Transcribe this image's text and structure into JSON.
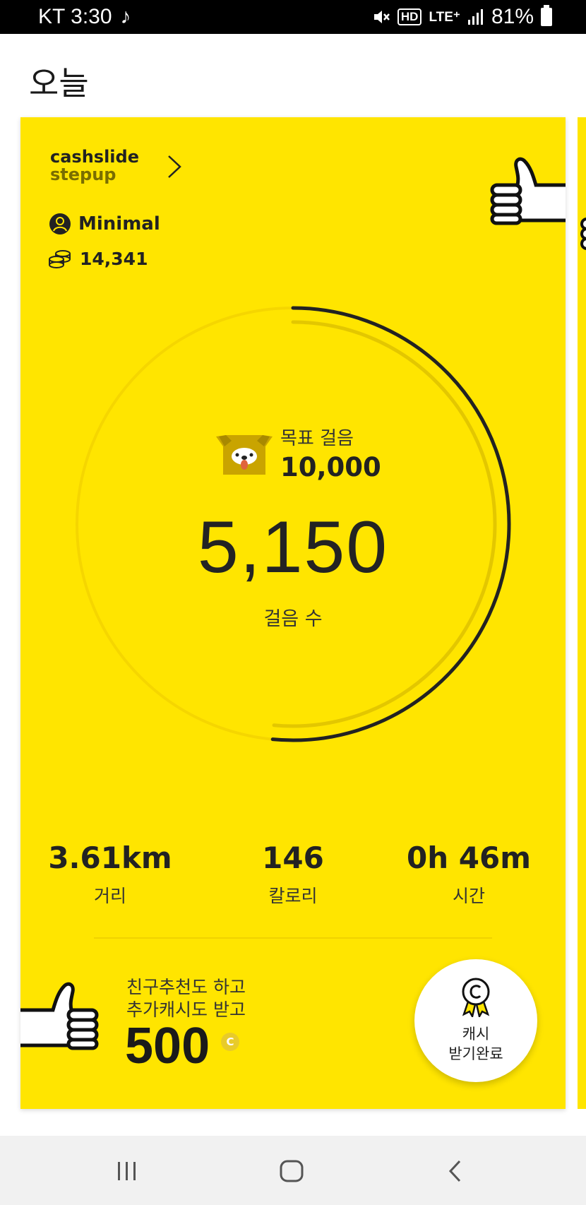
{
  "status_bar": {
    "carrier_time": "KT 3:30",
    "music_icon": "music-note-icon",
    "hd_label": "HD",
    "network": "LTE⁺",
    "battery_percent": "81%"
  },
  "header": {
    "title": "오늘"
  },
  "card": {
    "brand_line1": "cashslide",
    "brand_line2": "stepup",
    "profile_name": "Minimal",
    "coins": "14,341",
    "goal_label": "목표 걸음",
    "goal_value": "10,000",
    "steps_value": "5,150",
    "steps_label": "걸음 수",
    "progress_fraction": 0.515,
    "stats": [
      {
        "value": "3.61km",
        "label": "거리"
      },
      {
        "value": "146",
        "label": "칼로리"
      },
      {
        "value": "0h 46m",
        "label": "시간"
      }
    ],
    "promo_line1": "친구추천도 하고",
    "promo_line2": "추가캐시도 받고",
    "promo_amount": "500",
    "promo_coin_symbol": "C",
    "reward_line1": "캐시",
    "reward_line2": "받기완료",
    "accent_color": "#ffe500"
  },
  "nav": {
    "recent_icon": "recent-apps-icon",
    "home_icon": "home-icon",
    "back_icon": "back-icon"
  }
}
